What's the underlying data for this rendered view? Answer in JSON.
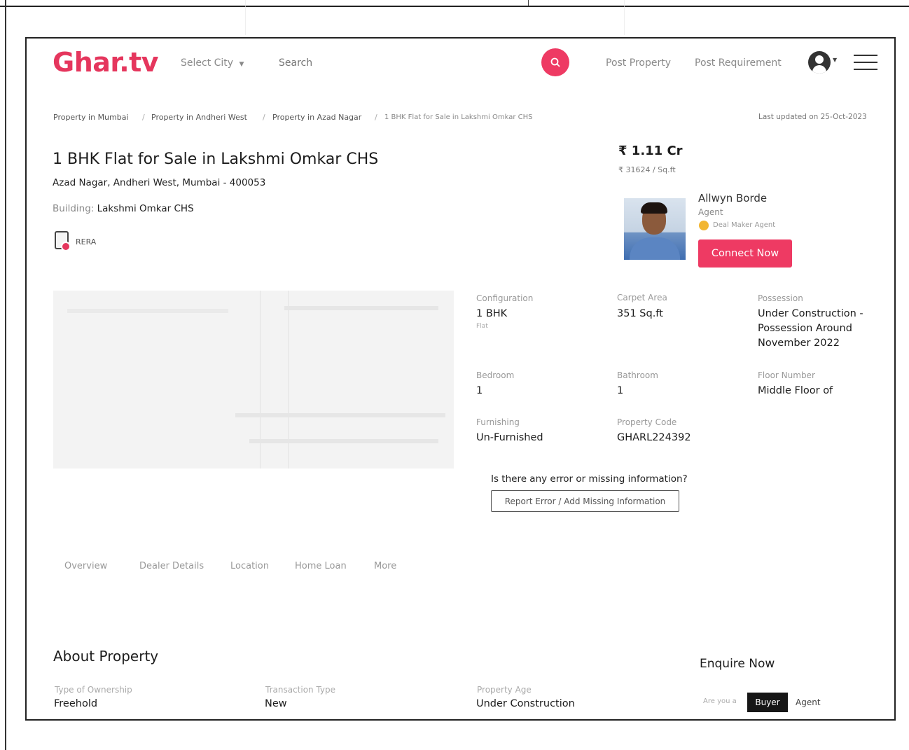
{
  "brand": {
    "logo": "Ghar.tv",
    "accent_color": "#ee3a63",
    "logo_color": "#e5365d"
  },
  "header": {
    "city_select": "Select City",
    "search_placeholder": "Search",
    "post_property": "Post Property",
    "post_requirement": "Post Requirement"
  },
  "breadcrumb": {
    "items": [
      "Property in Mumbai",
      "Property in Andheri West",
      "Property in Azad Nagar",
      "1 BHK Flat for Sale in Lakshmi Omkar CHS"
    ],
    "separator": "/",
    "last_updated": "Last updated on 25-Oct-2023"
  },
  "listing": {
    "title": "1 BHK Flat for Sale in Lakshmi Omkar CHS",
    "address": "Azad Nagar, Andheri West, Mumbai - 400053",
    "building_label": "Building:",
    "building_name": "Lakshmi Omkar CHS",
    "rera": "RERA",
    "price": "₹ 1.11 Cr",
    "price_per_sqft": "₹ 31624 / Sq.ft"
  },
  "agent": {
    "name": "Allwyn Borde",
    "role": "Agent",
    "badge": "Deal Maker Agent",
    "connect_label": "Connect Now"
  },
  "specs": [
    {
      "label": "Configuration",
      "value": "1 BHK",
      "sub": "Flat"
    },
    {
      "label": "Carpet Area",
      "value": "351 Sq.ft"
    },
    {
      "label": "Possession",
      "value_lines": [
        "Under Construction -",
        "Possession Around",
        "November 2022"
      ]
    },
    {
      "label": "Bedroom",
      "value": "1"
    },
    {
      "label": "Bathroom",
      "value": "1"
    },
    {
      "label": "Floor Number",
      "value": "Middle Floor of"
    },
    {
      "label": "Furnishing",
      "value": "Un-Furnished"
    },
    {
      "label": "Property Code",
      "value": "GHARL224392"
    }
  ],
  "report": {
    "question": "Is there any error or missing information?",
    "button": "Report Error / Add Missing Information"
  },
  "tabs": [
    "Overview",
    "Dealer Details",
    "Location",
    "Home Loan",
    "More"
  ],
  "about": {
    "title": "About Property",
    "fields": [
      {
        "label": "Type of Ownership",
        "value": "Freehold"
      },
      {
        "label": "Transaction Type",
        "value": "New"
      },
      {
        "label": "Property Age",
        "value": "Under Construction"
      }
    ]
  },
  "enquire": {
    "title": "Enquire Now",
    "question": "Are you a",
    "options": [
      "Buyer",
      "Agent"
    ],
    "selected": "Buyer"
  }
}
